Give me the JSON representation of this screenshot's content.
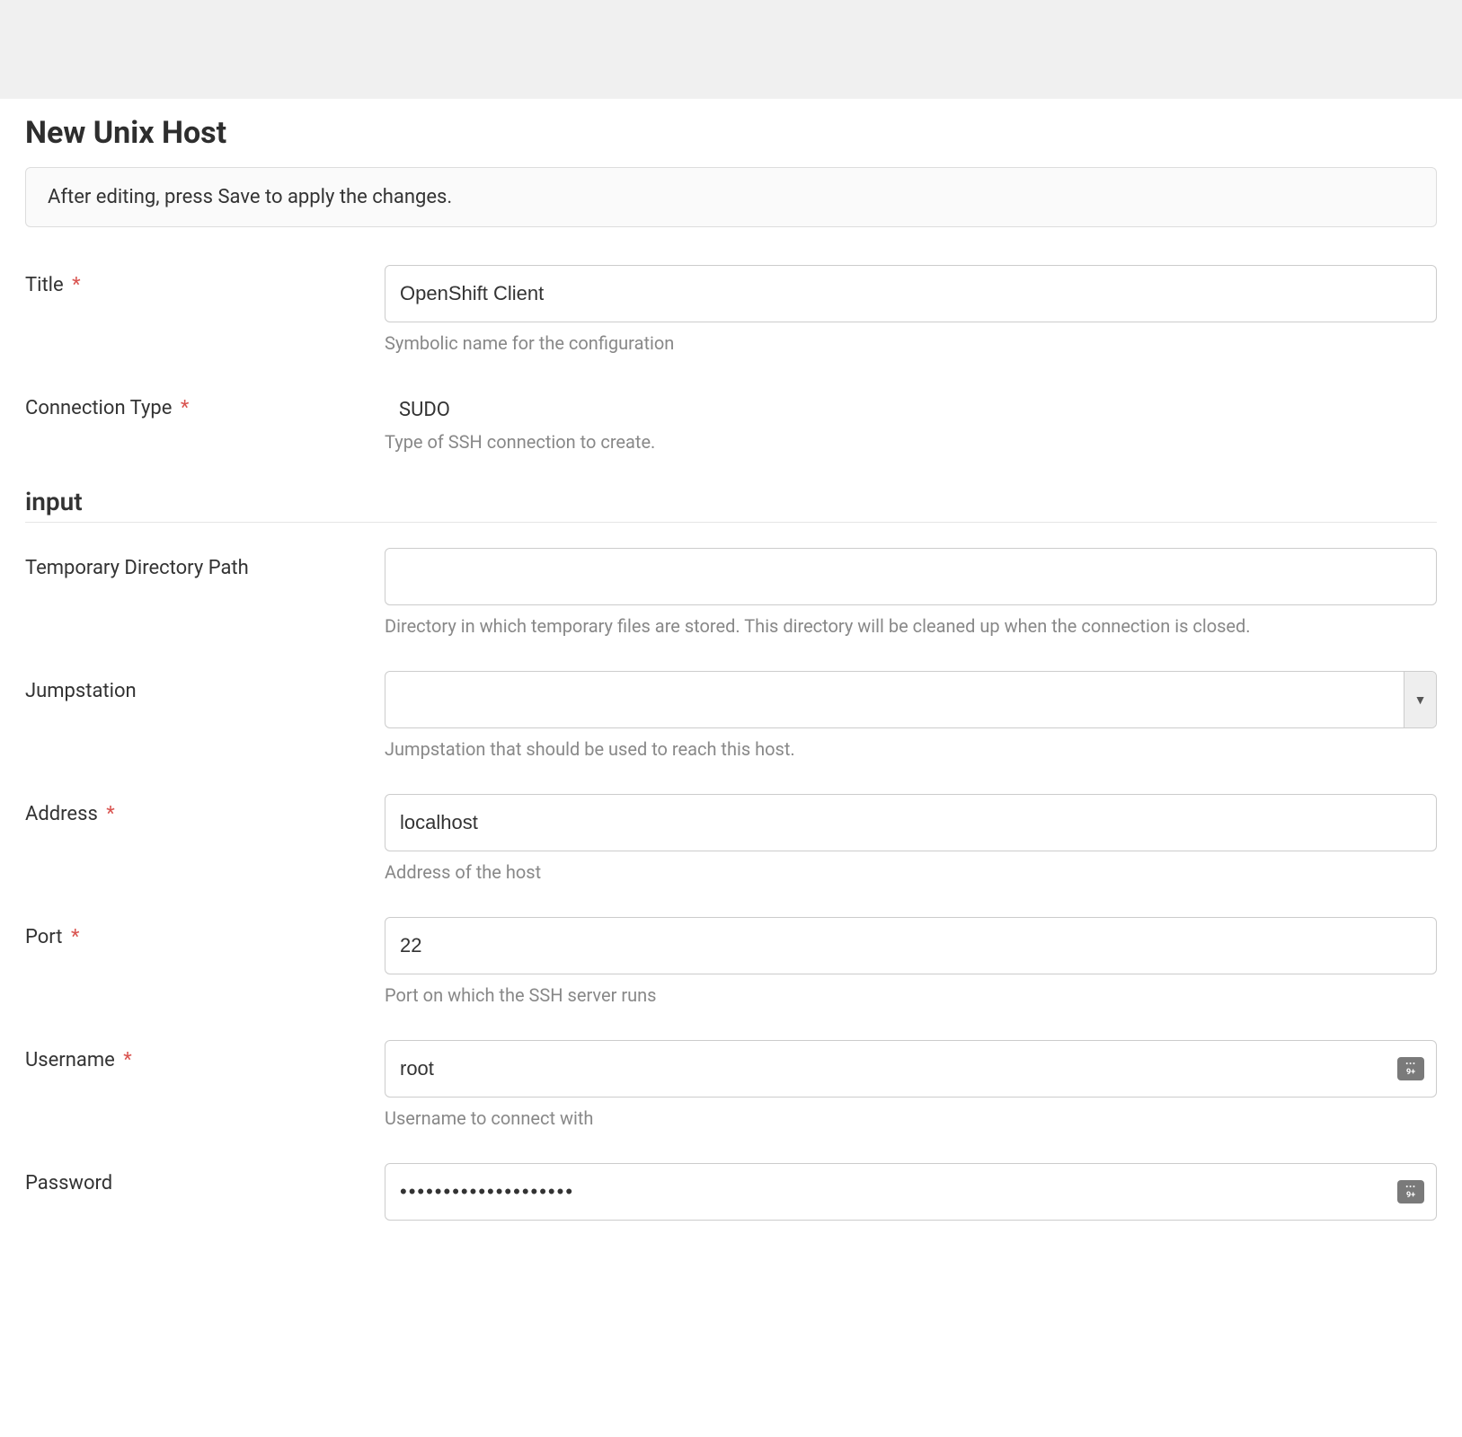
{
  "page": {
    "title": "New Unix Host",
    "info_message": "After editing, press Save to apply the changes."
  },
  "fields": {
    "title": {
      "label": "Title",
      "required_mark": "*",
      "value": "OpenShift Client",
      "help": "Symbolic name for the configuration"
    },
    "connection_type": {
      "label": "Connection Type",
      "required_mark": "*",
      "value": "SUDO",
      "help": "Type of SSH connection to create."
    }
  },
  "section_input": {
    "heading": "input",
    "temp_dir": {
      "label": "Temporary Directory Path",
      "value": "",
      "help": "Directory in which temporary files are stored. This directory will be cleaned up when the connection is closed."
    },
    "jumpstation": {
      "label": "Jumpstation",
      "value": "",
      "help": "Jumpstation that should be used to reach this host."
    },
    "address": {
      "label": "Address",
      "required_mark": "*",
      "value": "localhost",
      "help": "Address of the host"
    },
    "port": {
      "label": "Port",
      "required_mark": "*",
      "value": "22",
      "help": "Port on which the SSH server runs"
    },
    "username": {
      "label": "Username",
      "required_mark": "*",
      "value": "root",
      "help": "Username to connect with"
    },
    "password": {
      "label": "Password",
      "value": "••••••••••••••••••••"
    }
  }
}
